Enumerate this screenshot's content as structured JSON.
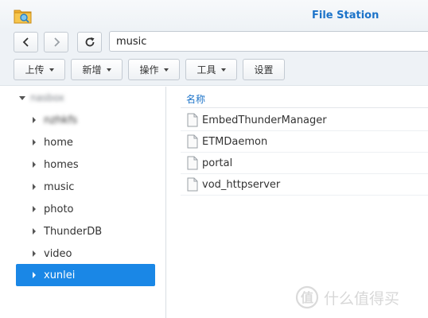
{
  "window": {
    "title": "File Station",
    "app_icon": "folder-search-icon"
  },
  "nav": {
    "back_icon": "chevron-left-icon",
    "forward_icon": "chevron-right-icon",
    "refresh_icon": "refresh-icon",
    "path_value": "music"
  },
  "toolbar": {
    "upload_label": "上传",
    "create_label": "新增",
    "action_label": "操作",
    "tools_label": "工具",
    "settings_label": "设置"
  },
  "tree": {
    "root_label": "nasbox",
    "items": [
      {
        "label": "nzhkfs"
      },
      {
        "label": "home"
      },
      {
        "label": "homes"
      },
      {
        "label": "music"
      },
      {
        "label": "photo"
      },
      {
        "label": "ThunderDB"
      },
      {
        "label": "video"
      },
      {
        "label": "xunlei"
      }
    ],
    "selected_index": 7
  },
  "file_list": {
    "column_name": "名称",
    "files": [
      {
        "name": "EmbedThunderManager"
      },
      {
        "name": "ETMDaemon"
      },
      {
        "name": "portal"
      },
      {
        "name": "vod_httpserver"
      }
    ]
  },
  "watermark": {
    "text": "什么值得买",
    "icon": "smzdm-logo-icon"
  },
  "colors": {
    "accent": "#1c73c9",
    "selection": "#1a87e6"
  }
}
